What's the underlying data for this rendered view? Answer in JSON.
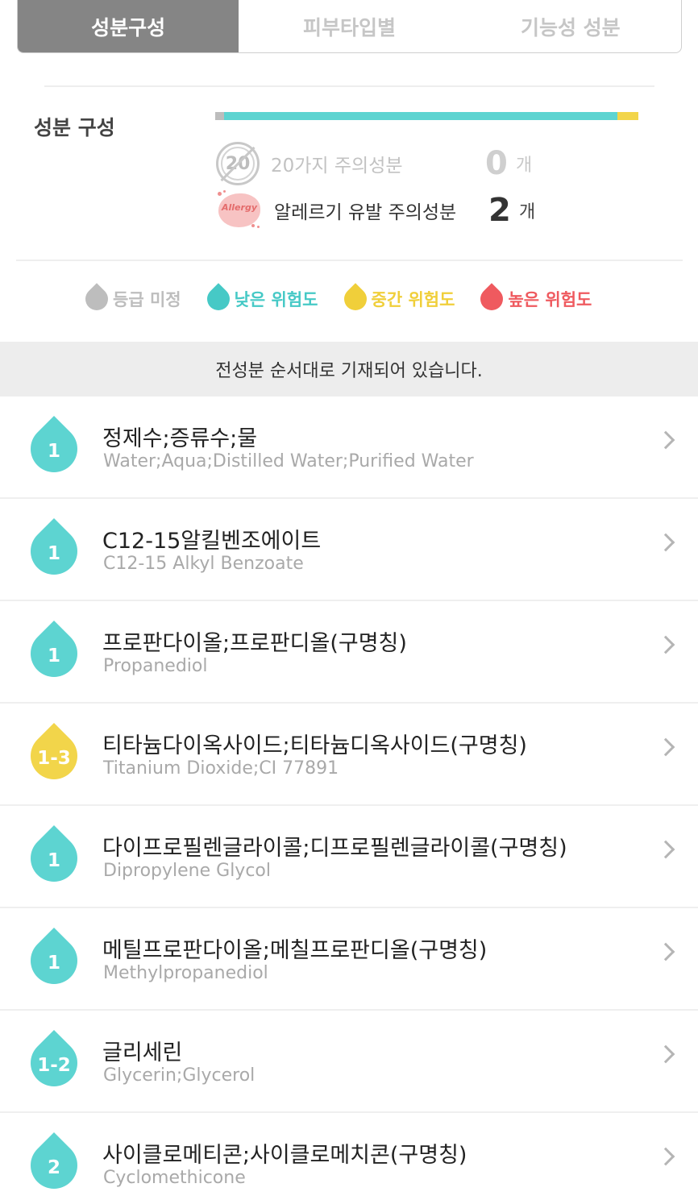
{
  "tabs": [
    {
      "label": "성분구성",
      "active": true
    },
    {
      "label": "피부타입별",
      "active": false
    },
    {
      "label": "기능성 성분",
      "active": false
    }
  ],
  "composition": {
    "title": "성분 구성",
    "bar": {
      "unrated_fraction": 0.02,
      "low_fraction": 0.93,
      "mid_fraction": 0.05
    }
  },
  "warnings": [
    {
      "badge_text": "20",
      "label": "20가지 주의성분",
      "count": "0",
      "unit": "개"
    },
    {
      "badge_text": "Allergy",
      "label": "알레르기 유발 주의성분",
      "count": "2",
      "unit": "개"
    }
  ],
  "legend": [
    {
      "label": "등급 미정",
      "color": "#bdbdbd"
    },
    {
      "label": "낮은 위험도",
      "color": "#46c9c6"
    },
    {
      "label": "중간 위험도",
      "color": "#f0cf3a"
    },
    {
      "label": "높은 위험도",
      "color": "#ef5a5f"
    }
  ],
  "notice": "전성분 순서대로 기재되어 있습니다.",
  "ingredients": [
    {
      "grade": "1",
      "color": "#5dd4d1",
      "name_kr": "정제수;증류수;물",
      "name_en": "Water;Aqua;Distilled Water;Purified Water"
    },
    {
      "grade": "1",
      "color": "#5dd4d1",
      "name_kr": "C12-15알킬벤조에이트",
      "name_en": "C12-15 Alkyl Benzoate"
    },
    {
      "grade": "1",
      "color": "#5dd4d1",
      "name_kr": "프로판다이올;프로판디올(구명칭)",
      "name_en": "Propanediol"
    },
    {
      "grade": "1-3",
      "color": "#f2d54a",
      "name_kr": "티타늄다이옥사이드;티타늄디옥사이드(구명칭)",
      "name_en": "Titanium Dioxide;CI 77891"
    },
    {
      "grade": "1",
      "color": "#5dd4d1",
      "name_kr": "다이프로필렌글라이콜;디프로필렌글라이콜(구명칭)",
      "name_en": "Dipropylene Glycol"
    },
    {
      "grade": "1",
      "color": "#5dd4d1",
      "name_kr": "메틸프로판다이올;메칠프로판디올(구명칭)",
      "name_en": "Methylpropanediol"
    },
    {
      "grade": "1-2",
      "color": "#5dd4d1",
      "name_kr": "글리세린",
      "name_en": "Glycerin;Glycerol"
    },
    {
      "grade": "2",
      "color": "#5dd4d1",
      "name_kr": "사이클로메티콘;사이클로메치콘(구명칭)",
      "name_en": "Cyclomethicone"
    }
  ]
}
